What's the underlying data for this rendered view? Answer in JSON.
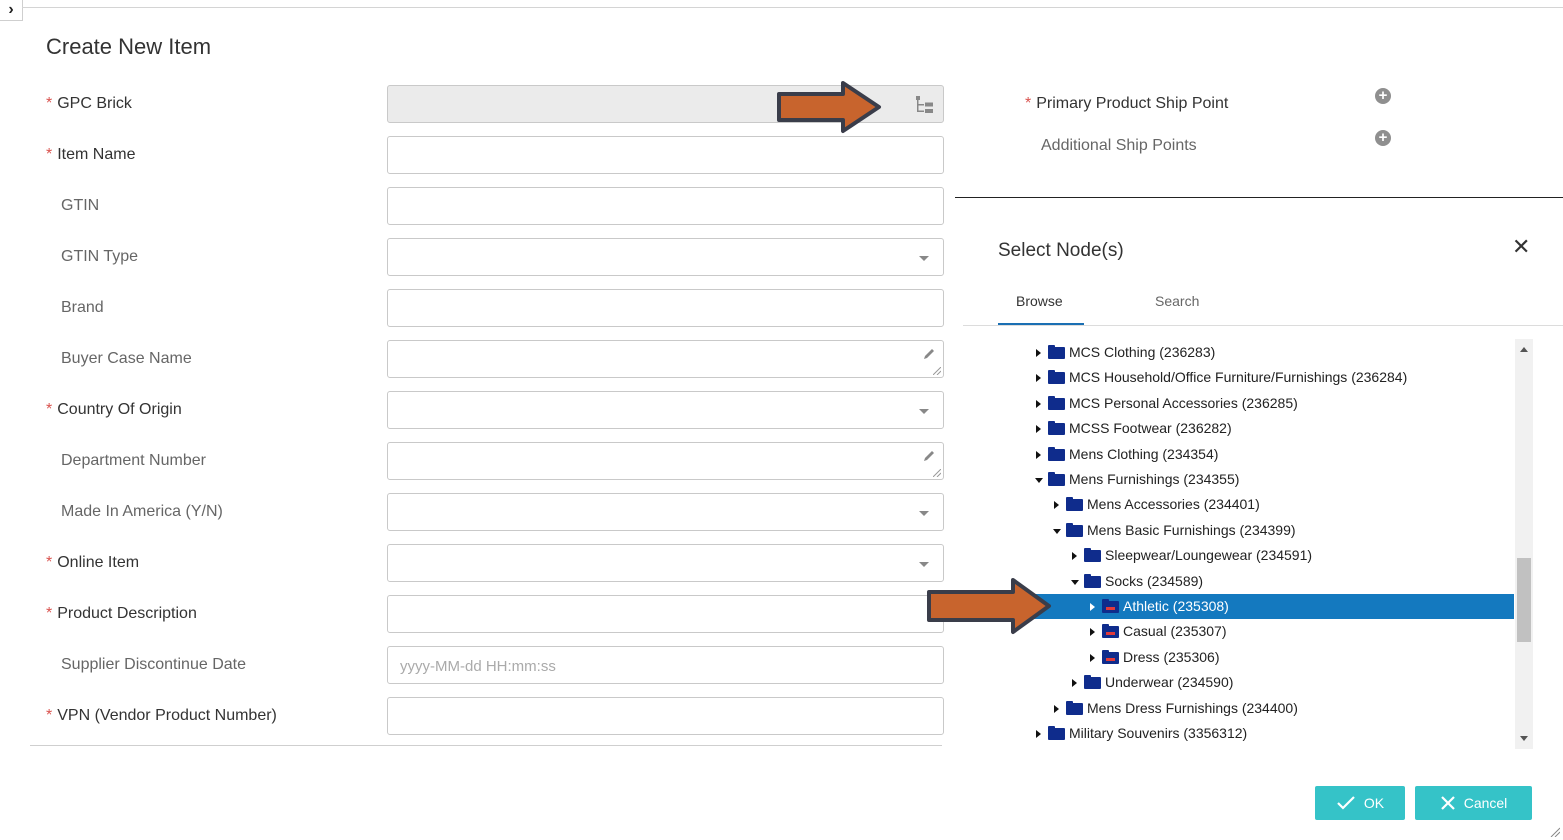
{
  "page": {
    "title": "Create New Item",
    "collapse_icon": "chevron-right-icon"
  },
  "form": {
    "gpc_brick": {
      "label": "GPC Brick",
      "required": true,
      "icon": "tree-view-icon"
    },
    "item_name": {
      "label": "Item Name",
      "required": true
    },
    "gtin": {
      "label": "GTIN"
    },
    "gtin_type": {
      "label": "GTIN Type"
    },
    "brand": {
      "label": "Brand"
    },
    "buyer_case_name": {
      "label": "Buyer Case Name"
    },
    "country_of_origin": {
      "label": "Country Of Origin",
      "required": true
    },
    "department_number": {
      "label": "Department Number"
    },
    "made_in_america": {
      "label": "Made In America (Y/N)"
    },
    "online_item": {
      "label": "Online Item",
      "required": true
    },
    "product_description": {
      "label": "Product Description",
      "required": true
    },
    "supplier_discontinue_date": {
      "label": "Supplier Discontinue Date",
      "placeholder": "yyyy-MM-dd HH:mm:ss"
    },
    "vpn": {
      "label": "VPN (Vendor Product Number)",
      "required": true
    },
    "required_marker": "*"
  },
  "ship_points": {
    "primary_label": "Primary Product Ship Point",
    "additional_label": "Additional Ship Points"
  },
  "dialog": {
    "title": "Select Node(s)",
    "close_glyph": "✕",
    "tabs": [
      {
        "label": "Browse",
        "active": true
      },
      {
        "label": "Search",
        "active": false
      }
    ],
    "tree": [
      {
        "label": "MCS Clothing (236283)",
        "depth": 0,
        "state": "collapsed",
        "kind": "folder"
      },
      {
        "label": "MCS Household/Office Furniture/Furnishings (236284)",
        "depth": 0,
        "state": "collapsed",
        "kind": "folder"
      },
      {
        "label": "MCS Personal Accessories (236285)",
        "depth": 0,
        "state": "collapsed",
        "kind": "folder"
      },
      {
        "label": "MCSS Footwear (236282)",
        "depth": 0,
        "state": "collapsed",
        "kind": "folder"
      },
      {
        "label": "Mens Clothing (234354)",
        "depth": 0,
        "state": "collapsed",
        "kind": "folder"
      },
      {
        "label": "Mens Furnishings (234355)",
        "depth": 0,
        "state": "expanded",
        "kind": "folder"
      },
      {
        "label": "Mens Accessories (234401)",
        "depth": 1,
        "state": "collapsed",
        "kind": "folder"
      },
      {
        "label": "Mens Basic Furnishings (234399)",
        "depth": 1,
        "state": "expanded",
        "kind": "folder"
      },
      {
        "label": "Sleepwear/Loungewear (234591)",
        "depth": 2,
        "state": "collapsed",
        "kind": "folder"
      },
      {
        "label": "Socks (234589)",
        "depth": 2,
        "state": "expanded",
        "kind": "folder"
      },
      {
        "label": "Athletic (235308)",
        "depth": 3,
        "state": "collapsed",
        "kind": "leaf",
        "selected": true
      },
      {
        "label": "Casual (235307)",
        "depth": 3,
        "state": "collapsed",
        "kind": "leaf"
      },
      {
        "label": "Dress (235306)",
        "depth": 3,
        "state": "collapsed",
        "kind": "leaf"
      },
      {
        "label": "Underwear (234590)",
        "depth": 2,
        "state": "collapsed",
        "kind": "folder"
      },
      {
        "label": "Mens Dress Furnishings (234400)",
        "depth": 1,
        "state": "collapsed",
        "kind": "folder"
      },
      {
        "label": "Military Souvenirs (3356312)",
        "depth": 0,
        "state": "collapsed",
        "kind": "folder"
      }
    ],
    "ok_label": "OK",
    "cancel_label": "Cancel",
    "ok_icon": "check-icon",
    "cancel_icon": "close-icon"
  },
  "colors": {
    "accent": "#35c3c8",
    "selection": "#1479bf",
    "annotation_arrow": "#c8642d",
    "required_star": "#d9534f",
    "folder": "#0f2c8c"
  }
}
